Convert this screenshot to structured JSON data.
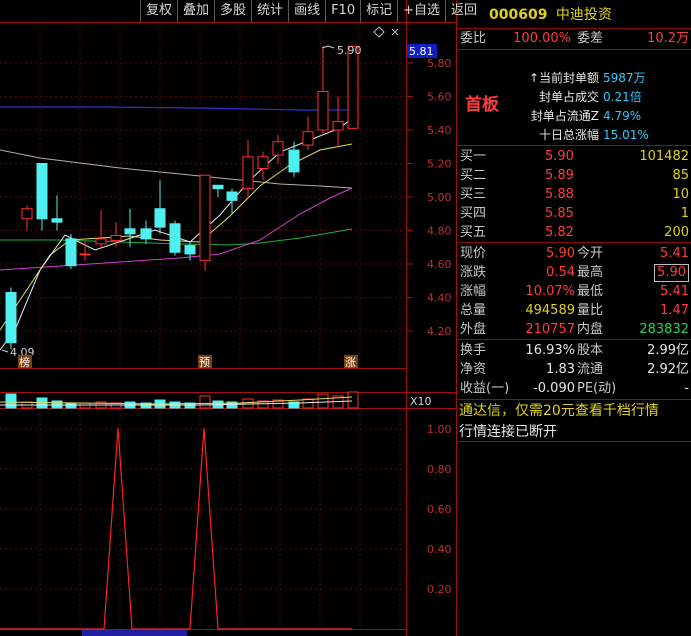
{
  "toolbar": [
    "复权",
    "叠加",
    "多股",
    "统计",
    "画线",
    "F10",
    "标记",
    "+自选",
    "返回"
  ],
  "chart": {
    "price_axis": [
      "5.80",
      "5.60",
      "5.40",
      "5.20",
      "5.00",
      "4.80",
      "4.60",
      "4.40",
      "4.20"
    ],
    "price_tag": "5.81",
    "high_label": "5.90",
    "low_label": "4.09",
    "markers": [
      "榜",
      "预",
      "涨"
    ],
    "volume_axis": "X10",
    "indicator_axis": [
      "1.00",
      "0.80",
      "0.60",
      "0.40",
      "0.20"
    ]
  },
  "stock": {
    "code": "000609",
    "name": "中迪投资"
  },
  "weibi": {
    "label": "委比",
    "value": "100.00%",
    "label2": "委差",
    "value2": "10.2万"
  },
  "board": {
    "title": "首板",
    "items": [
      {
        "label": "↑当前封单额",
        "value": "5987万"
      },
      {
        "label": "封单占成交",
        "value": "0.21倍"
      },
      {
        "label": "封单占流通Z",
        "value": "4.79%"
      },
      {
        "label": "十日总涨幅",
        "value": "15.01%"
      }
    ]
  },
  "bids": [
    {
      "label": "买一",
      "price": "5.90",
      "vol": "101482"
    },
    {
      "label": "买二",
      "price": "5.89",
      "vol": "85"
    },
    {
      "label": "买三",
      "price": "5.88",
      "vol": "10"
    },
    {
      "label": "买四",
      "price": "5.85",
      "vol": "1"
    },
    {
      "label": "买五",
      "price": "5.82",
      "vol": "200"
    }
  ],
  "quote": [
    {
      "l1": "现价",
      "v1": "5.90",
      "l2": "今开",
      "v2": "5.41"
    },
    {
      "l1": "涨跌",
      "v1": "0.54",
      "l2": "最高",
      "v2": "5.90"
    },
    {
      "l1": "涨幅",
      "v1": "10.07%",
      "l2": "最低",
      "v2": "5.41"
    },
    {
      "l1": "总量",
      "v1": "494589",
      "l2": "量比",
      "v2": "1.47"
    },
    {
      "l1": "外盘",
      "v1": "210757",
      "l2": "内盘",
      "v2": "283832"
    }
  ],
  "fin": [
    {
      "l1": "换手",
      "v1": "16.93%",
      "l2": "股本",
      "v2": "2.99亿"
    },
    {
      "l1": "净资",
      "v1": "1.83",
      "l2": "流通",
      "v2": "2.92亿"
    },
    {
      "l1": "收益(一)",
      "v1": "-0.090",
      "l2": "PE(动)",
      "v2": "-"
    }
  ],
  "notice": "通达信，仅需20元查看千档行情",
  "status": "行情连接已断开"
}
